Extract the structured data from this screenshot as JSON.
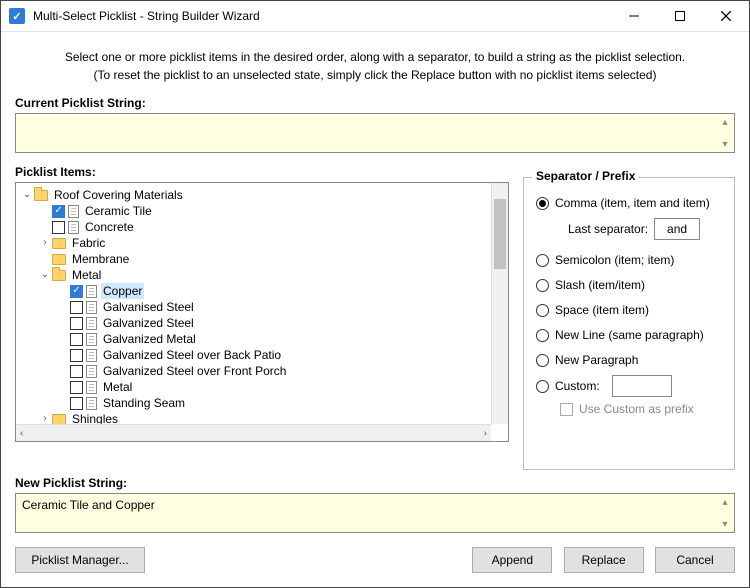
{
  "window": {
    "title": "Multi-Select Picklist - String Builder Wizard"
  },
  "instructions": {
    "line1": "Select one or more picklist items in the desired order, along with a separator, to build a string as the picklist selection.",
    "line2": "(To reset the picklist to an unselected state, simply click the Replace button with no picklist items selected)"
  },
  "labels": {
    "current": "Current Picklist String:",
    "items": "Picklist Items:",
    "new": "New Picklist String:",
    "separator_group": "Separator / Prefix",
    "last_separator": "Last separator:"
  },
  "current_value": "",
  "new_value": "Ceramic Tile and Copper",
  "tree": {
    "root": "Roof Covering Materials",
    "lvl1": {
      "ceramic": "Ceramic Tile",
      "concrete": "Concrete",
      "fabric": "Fabric",
      "membrane": "Membrane",
      "metal": "Metal",
      "shingles": "Shingles"
    },
    "metal_children": {
      "copper": "Copper",
      "galv_steel1": "Galvanised Steel",
      "galv_steel2": "Galvanized Steel",
      "galv_metal": "Galvanized Metal",
      "galv_back": "Galvanized Steel over Back Patio",
      "galv_front": "Galvanized Steel over Front Porch",
      "metal2": "Metal",
      "standing": "Standing Seam"
    }
  },
  "separator": {
    "comma": "Comma (item, item and item)",
    "last_sep_value": "and",
    "semicolon": "Semicolon (item; item)",
    "slash": "Slash (item/item)",
    "space": "Space (item item)",
    "newline": "New Line (same paragraph)",
    "newpara": "New Paragraph",
    "custom": "Custom:",
    "use_custom_prefix": "Use Custom as prefix"
  },
  "buttons": {
    "picklist_manager": "Picklist Manager...",
    "append": "Append",
    "replace": "Replace",
    "cancel": "Cancel"
  }
}
